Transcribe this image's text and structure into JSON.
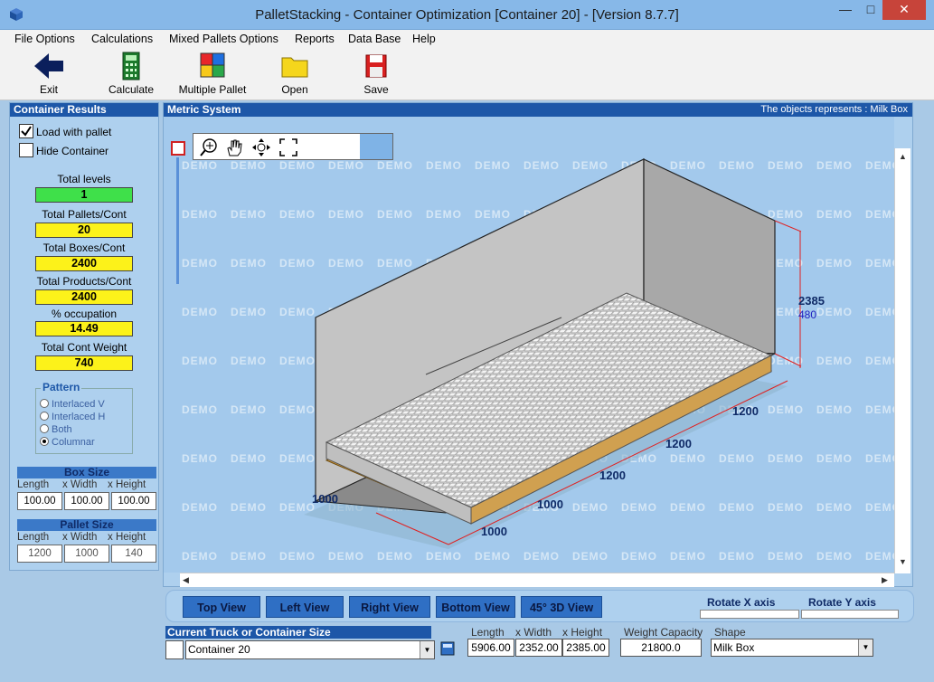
{
  "window": {
    "title": "PalletStacking - Container Optimization [Container 20] - [Version 8.7.7]"
  },
  "menu": [
    "File Options",
    "Calculations",
    "Mixed Pallets Options",
    "Reports",
    "Data Base",
    "Help"
  ],
  "toolbar": {
    "exit": "Exit",
    "calculate": "Calculate",
    "multiple_pallet": "Multiple Pallet",
    "open": "Open",
    "save": "Save"
  },
  "results": {
    "header": "Container Results",
    "load_with_pallet": "Load with pallet",
    "load_with_pallet_checked": true,
    "hide_container": "Hide Container",
    "hide_container_checked": false,
    "total_levels_label": "Total levels",
    "total_levels": "1",
    "total_pallets_label": "Total Pallets/Cont",
    "total_pallets": "20",
    "total_boxes_label": "Total Boxes/Cont",
    "total_boxes": "2400",
    "total_products_label": "Total Products/Cont",
    "total_products": "2400",
    "occupation_label": "% occupation",
    "occupation": "14.49",
    "total_weight_label": "Total Cont Weight",
    "total_weight": "740"
  },
  "pattern": {
    "title": "Pattern",
    "options": [
      "Interlaced V",
      "Interlaced H",
      "Both",
      "Columnar"
    ],
    "selected": "Columnar"
  },
  "box_size": {
    "header": "Box Size",
    "length_label": "Length",
    "width_label": "x Width",
    "height_label": "x Height",
    "length": "100.00",
    "width": "100.00",
    "height": "100.00"
  },
  "pallet_size": {
    "header": "Pallet Size",
    "length_label": "Length",
    "width_label": "x Width",
    "height_label": "x Height",
    "length": "1200",
    "width": "1000",
    "height": "140"
  },
  "view": {
    "header": "Metric System",
    "objects_label": "The objects represents : Milk Box",
    "watermark": "DEMO",
    "dim_height": "2385",
    "dim_height2": "480",
    "dim_1200_a": "1200",
    "dim_1200_b": "1200",
    "dim_1200_c": "1200",
    "dim_1000_a": "1000",
    "dim_1000_b": "1000",
    "dim_1000_c": "1000"
  },
  "view_buttons": [
    "Top View",
    "Left View",
    "Right View",
    "Bottom View",
    "45° 3D View"
  ],
  "rotate": {
    "x_label": "Rotate X axis",
    "y_label": "Rotate Y axis"
  },
  "container": {
    "header": "Current Truck or Container Size",
    "selected": "Container 20",
    "length_label": "Length",
    "width_label": "x Width",
    "height_label": "x Height",
    "length": "5906.00",
    "width": "2352.00",
    "height": "2385.00",
    "weight_label": "Weight Capacity",
    "weight": "21800.0",
    "shape_label": "Shape",
    "shape": "Milk Box"
  },
  "colors": {
    "accent": "#1d57a8",
    "green": "#3fe04a",
    "yellow": "#fcf21a",
    "close": "#c7443a"
  }
}
